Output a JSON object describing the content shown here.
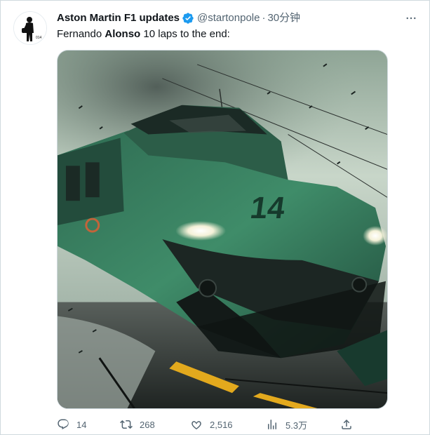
{
  "author": {
    "display_name": "Aston Martin F1 updates",
    "handle": "@startonpole",
    "separator": "·",
    "time": "30分钟",
    "verified": true,
    "avatar_icon": "silhouette-driver-avatar"
  },
  "tweet": {
    "text_before": "Fernando ",
    "text_bold": "Alonso",
    "text_after": " 10 laps to the end:"
  },
  "media": {
    "icon": "green-bullet-train-image",
    "car_number": "14"
  },
  "more_icon": "more-horizontal-icon",
  "actions": {
    "reply": {
      "icon": "reply-icon",
      "count": "14"
    },
    "retweet": {
      "icon": "retweet-icon",
      "count": "268"
    },
    "like": {
      "icon": "heart-icon",
      "count": "2,516"
    },
    "views": {
      "icon": "views-chart-icon",
      "count": "5.3万"
    },
    "share": {
      "icon": "share-icon",
      "count": ""
    }
  },
  "colors": {
    "text_primary": "#0f1419",
    "text_secondary": "#536471",
    "verified_blue": "#1d9bf0",
    "border": "#cfd9de"
  }
}
